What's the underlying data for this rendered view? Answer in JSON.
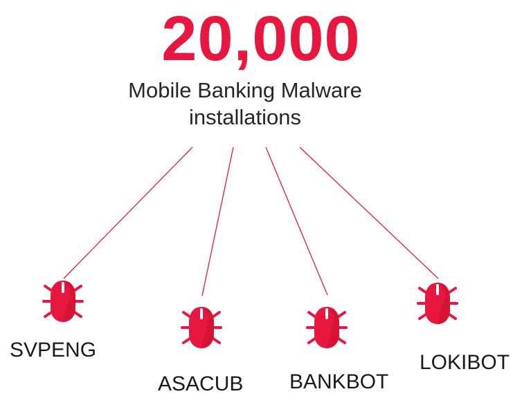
{
  "headline": {
    "value": "20,000",
    "line1": "Mobile Banking Malware",
    "line2": "installations"
  },
  "accent_color": "#e8173f",
  "text_color": "#262626",
  "malware": [
    {
      "name": "SVPENG",
      "icon": "bug-icon"
    },
    {
      "name": "ASACUB",
      "icon": "bug-icon"
    },
    {
      "name": "BANKBOT",
      "icon": "bug-icon"
    },
    {
      "name": "LOKIBOT",
      "icon": "bug-icon"
    }
  ]
}
